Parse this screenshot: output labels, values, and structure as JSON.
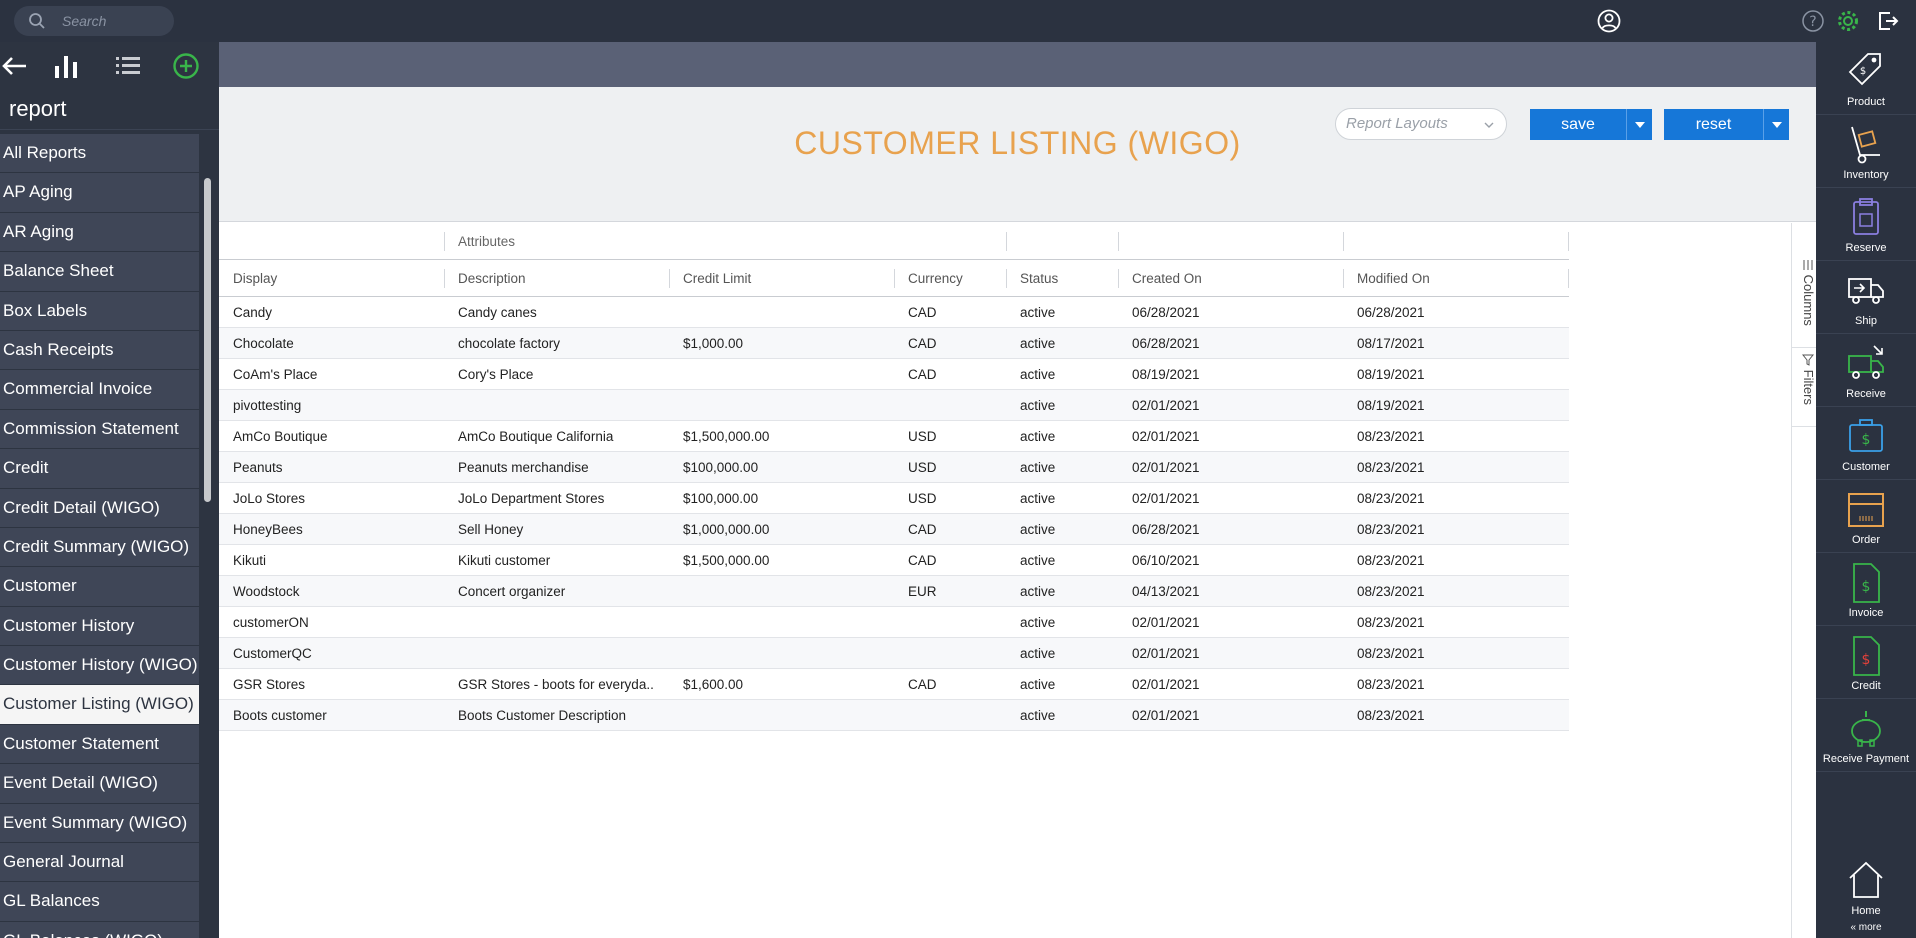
{
  "search": {
    "placeholder": "Search"
  },
  "left": {
    "title": "report",
    "items": [
      "All Reports",
      "AP Aging",
      "AR Aging",
      "Balance Sheet",
      "Box Labels",
      "Cash Receipts",
      "Commercial Invoice",
      "Commission Statement",
      "Credit",
      "Credit Detail (WIGO)",
      "Credit Summary (WIGO)",
      "Customer",
      "Customer History",
      "Customer History (WIGO)",
      "Customer Listing (WIGO)",
      "Customer Statement",
      "Event Detail (WIGO)",
      "Event Summary (WIGO)",
      "General Journal",
      "GL Balances",
      "GL Balances (WIGO)"
    ],
    "active": "Customer Listing (WIGO)"
  },
  "report": {
    "title": "CUSTOMER LISTING (WIGO)",
    "layouts_placeholder": "Report Layouts",
    "save": "save",
    "reset": "reset"
  },
  "grid": {
    "group_header": "Attributes",
    "columns": [
      "Display",
      "Description",
      "Credit Limit",
      "Currency",
      "Status",
      "Created On",
      "Modified On"
    ],
    "rows": [
      [
        "Candy",
        "Candy canes",
        "",
        "CAD",
        "active",
        "06/28/2021",
        "06/28/2021"
      ],
      [
        "Chocolate",
        "chocolate factory",
        "$1,000.00",
        "CAD",
        "active",
        "06/28/2021",
        "08/17/2021"
      ],
      [
        "CoAm's Place",
        "Cory's Place",
        "",
        "CAD",
        "active",
        "08/19/2021",
        "08/19/2021"
      ],
      [
        "pivottesting",
        "",
        "",
        "",
        "active",
        "02/01/2021",
        "08/19/2021"
      ],
      [
        "AmCo Boutique",
        "AmCo Boutique California",
        "$1,500,000.00",
        "USD",
        "active",
        "02/01/2021",
        "08/23/2021"
      ],
      [
        "Peanuts",
        "Peanuts merchandise",
        "$100,000.00",
        "USD",
        "active",
        "02/01/2021",
        "08/23/2021"
      ],
      [
        "JoLo Stores",
        "JoLo Department Stores",
        "$100,000.00",
        "USD",
        "active",
        "02/01/2021",
        "08/23/2021"
      ],
      [
        "HoneyBees",
        "Sell Honey",
        "$1,000,000.00",
        "CAD",
        "active",
        "06/28/2021",
        "08/23/2021"
      ],
      [
        "Kikuti",
        "Kikuti customer",
        "$1,500,000.00",
        "CAD",
        "active",
        "06/10/2021",
        "08/23/2021"
      ],
      [
        "Woodstock",
        "Concert organizer",
        "",
        "EUR",
        "active",
        "04/13/2021",
        "08/23/2021"
      ],
      [
        "customerON",
        "",
        "",
        "",
        "active",
        "02/01/2021",
        "08/23/2021"
      ],
      [
        "CustomerQC",
        "",
        "",
        "",
        "active",
        "02/01/2021",
        "08/23/2021"
      ],
      [
        "GSR Stores",
        "GSR Stores - boots for everyda...",
        "$1,600.00",
        "CAD",
        "active",
        "02/01/2021",
        "08/23/2021"
      ],
      [
        "Boots customer",
        "Boots Customer Description",
        "",
        "",
        "active",
        "02/01/2021",
        "08/23/2021"
      ]
    ],
    "side_tabs": [
      "Columns",
      "Filters"
    ]
  },
  "right": {
    "items": [
      "Product",
      "Inventory",
      "Reserve",
      "Ship",
      "Receive",
      "Customer",
      "Order",
      "Invoice",
      "Credit",
      "Receive Payment"
    ],
    "home": "Home",
    "more": "« more"
  },
  "colors": {
    "accent_orange": "#e8a24e",
    "button_blue": "#1677d8",
    "green": "#39b54a",
    "nav_dark": "#2b3240"
  }
}
